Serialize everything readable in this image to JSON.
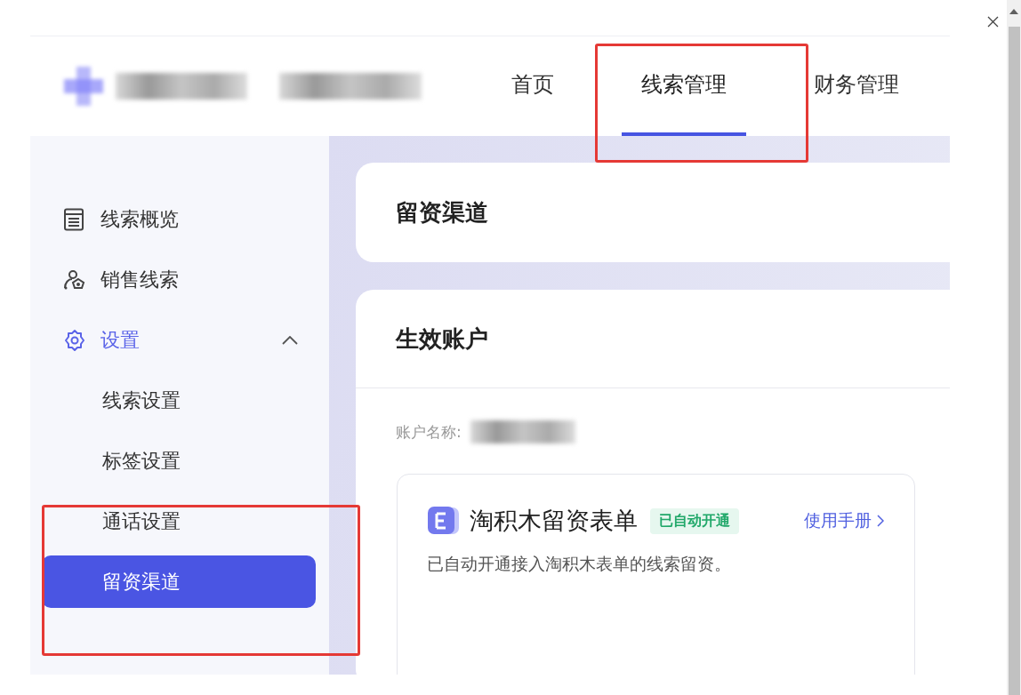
{
  "nav_tabs": [
    {
      "label": "首页",
      "selected": false,
      "annotated": false
    },
    {
      "label": "线索管理",
      "selected": true,
      "annotated": true
    },
    {
      "label": "财务管理",
      "selected": false,
      "annotated": false
    }
  ],
  "sidebar": {
    "items": [
      {
        "label": "线索概览",
        "selected": false
      },
      {
        "label": "销售线索",
        "selected": false
      },
      {
        "label": "设置",
        "selected": true,
        "expanded": true,
        "children": [
          {
            "label": "线索设置",
            "selected": false,
            "annotated": false
          },
          {
            "label": "标签设置",
            "selected": false,
            "annotated": false
          },
          {
            "label": "通话设置",
            "selected": false,
            "annotated": false
          },
          {
            "label": "留资渠道",
            "selected": true,
            "annotated": true
          }
        ]
      }
    ]
  },
  "page_title": "留资渠道",
  "section": {
    "title": "生效账户",
    "account_label": "账户名称:",
    "channel_card": {
      "title": "淘积木留资表单",
      "badge": "已自动开通",
      "link": "使用手册",
      "description": "已自动开通接入淘积木表单的线索留资。"
    }
  }
}
